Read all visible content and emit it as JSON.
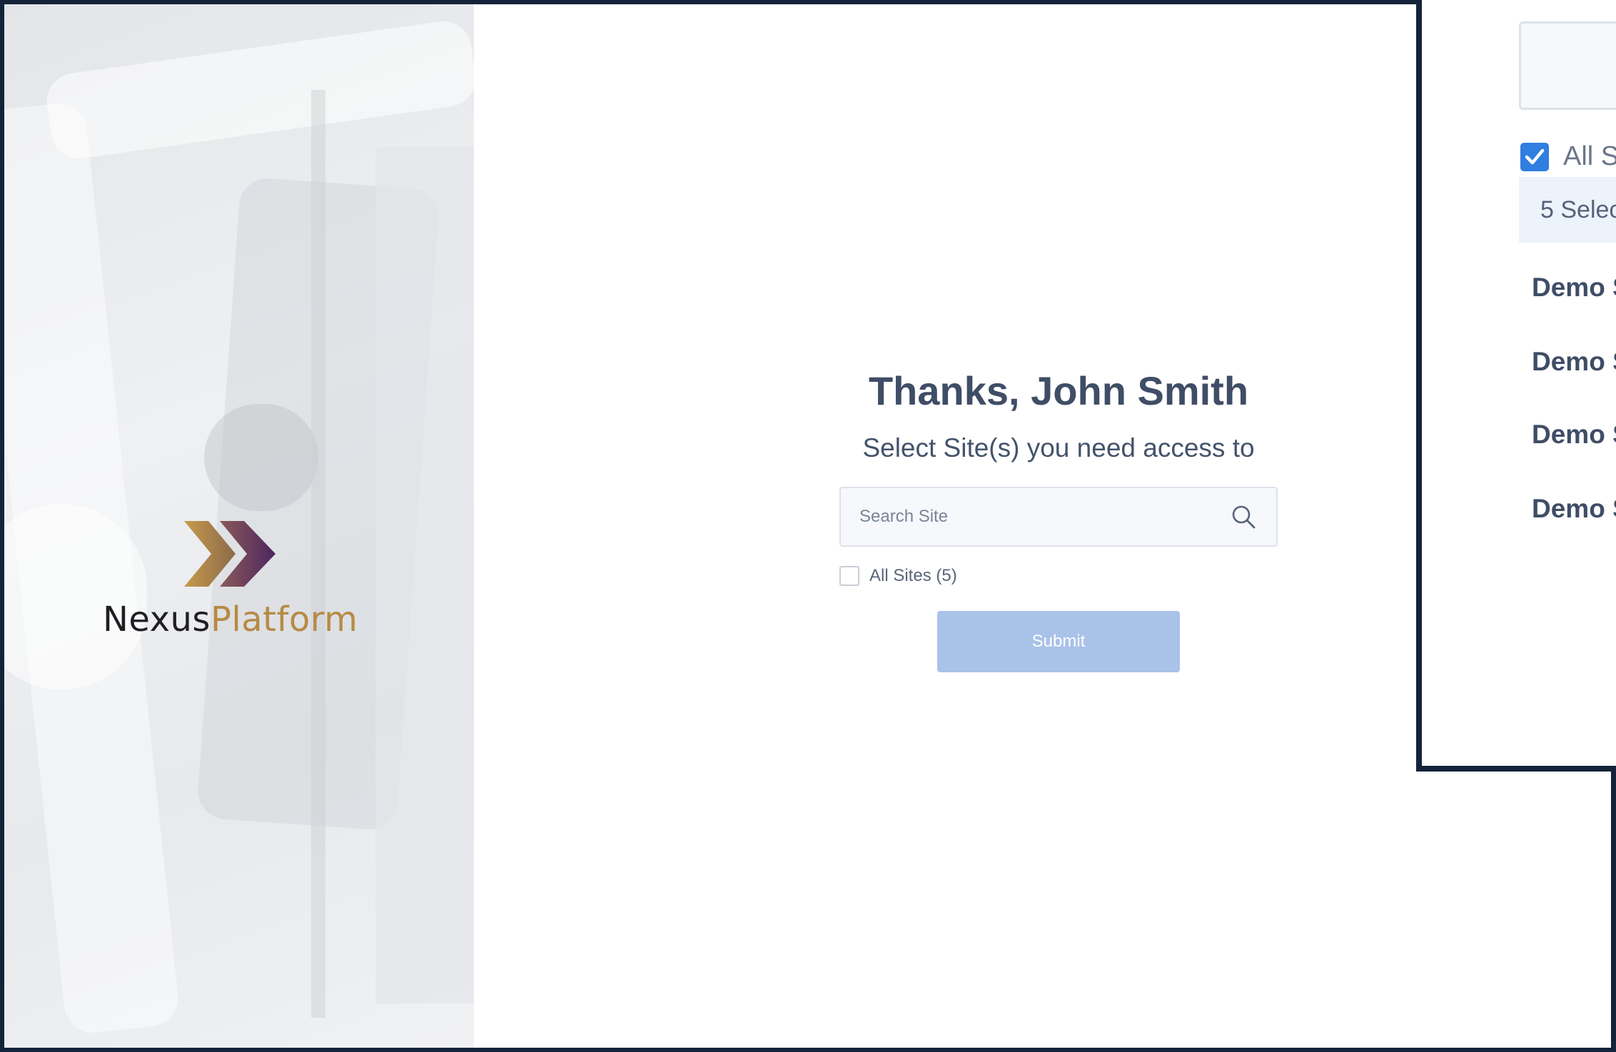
{
  "brand": {
    "name_part1": "Nexus",
    "name_part2": "Platform",
    "colors": {
      "gold": "#b78a44",
      "purple": "#5a2a63"
    }
  },
  "form": {
    "title": "Thanks, John Smith",
    "subtitle": "Select Site(s) you need access to",
    "search": {
      "placeholder": "Search Site",
      "value": ""
    },
    "all_sites_label": "All Sites (5)",
    "all_sites_checked": false,
    "submit_label": "Submit",
    "submit_enabled": false
  },
  "inset": {
    "all_sites_label": "All Si",
    "all_sites_checked": true,
    "selected_summary": "5 Selec",
    "sites": [
      "Demo S",
      "Demo S",
      "Demo S",
      "Demo S"
    ]
  },
  "colors": {
    "accent": "#2f7ee0",
    "submit_disabled": "#a9c2e8",
    "heading": "#3f4d66",
    "frame": "#14233a"
  }
}
